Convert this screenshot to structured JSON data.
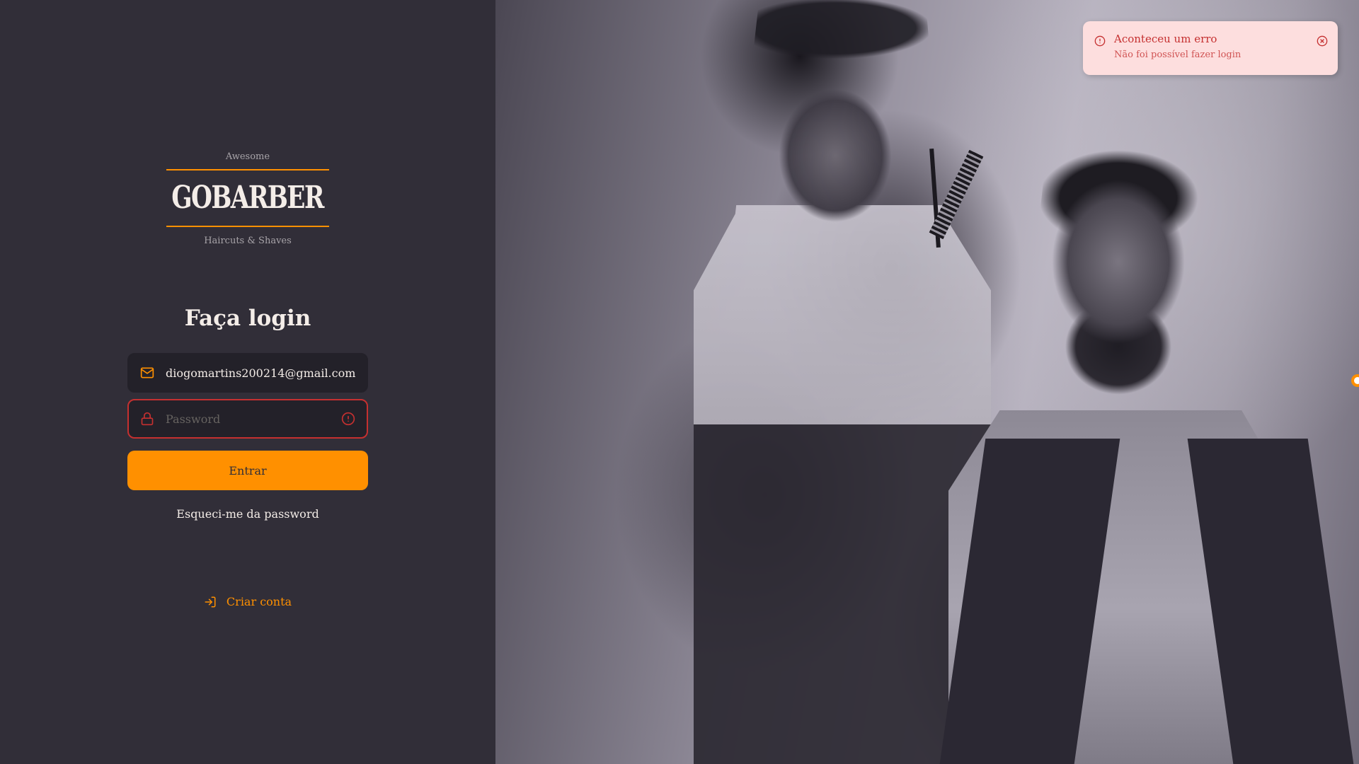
{
  "brand": {
    "tagline_top": "Awesome",
    "name": "GOBARBER",
    "tagline_bottom": "Haircuts & Shaves",
    "accent_color": "#ff9000"
  },
  "form": {
    "title": "Faça login",
    "email": {
      "value": "diogomartins200214@gmail.com",
      "icon": "mail-icon"
    },
    "password": {
      "placeholder": "Password",
      "icon": "lock-icon",
      "error_icon": "alert-circle-icon",
      "state": "error"
    },
    "submit_label": "Entrar",
    "forgot_label": "Esqueci-me da password"
  },
  "create_account": {
    "label": "Criar conta",
    "icon": "log-in-icon"
  },
  "toast": {
    "type": "error",
    "title": "Aconteceu um erro",
    "description": "Não foi possível fazer login",
    "icon": "alert-circle-icon",
    "close_icon": "x-circle-icon",
    "color": "#c53030",
    "background": "#fddede"
  }
}
